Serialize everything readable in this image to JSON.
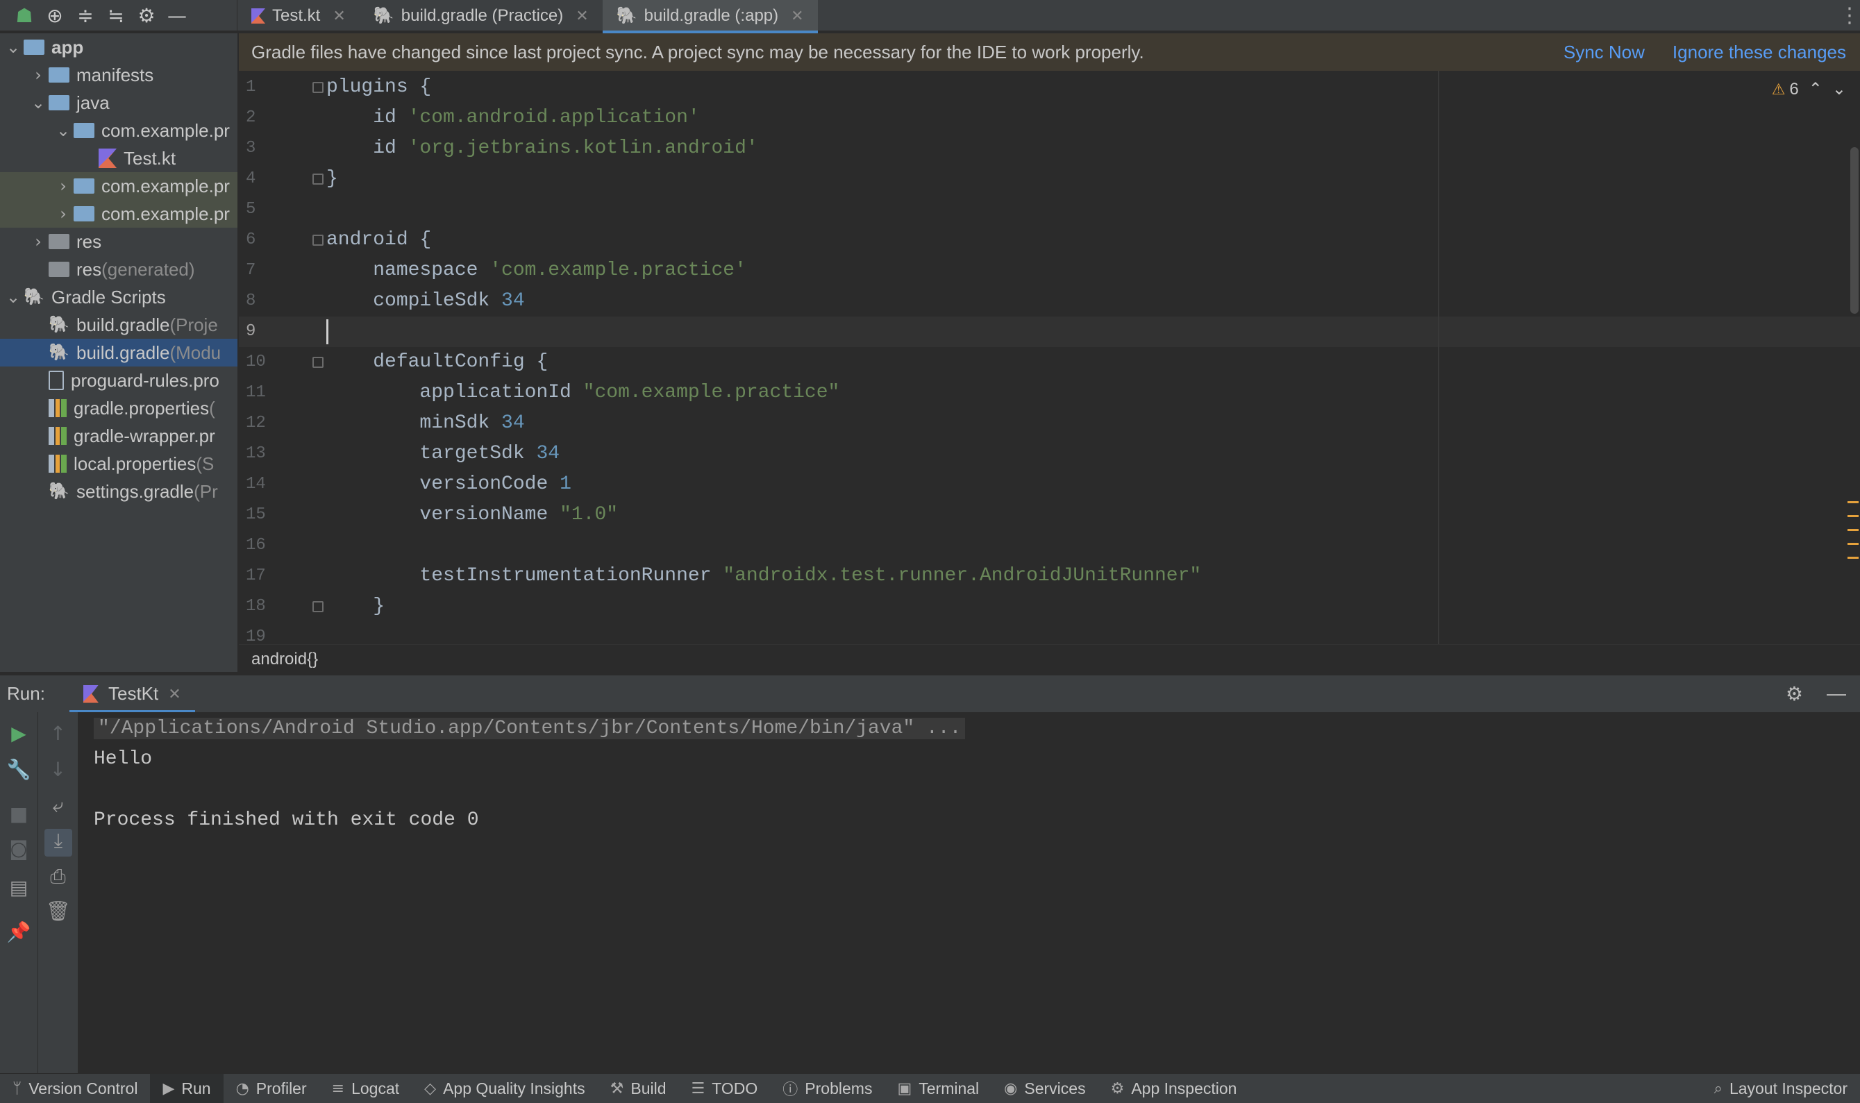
{
  "topbar": {
    "tool_icons": [
      "android-icon",
      "target-icon",
      "expand-all-icon",
      "collapse-all-icon",
      "gear-icon",
      "minimize-icon"
    ],
    "tabs": [
      {
        "label": "Test.kt",
        "icon": "kotlin-file-icon",
        "active": false
      },
      {
        "label": "build.gradle (Practice)",
        "icon": "gradle-icon",
        "active": false
      },
      {
        "label": "build.gradle (:app)",
        "icon": "gradle-icon",
        "active": true
      }
    ]
  },
  "tree": {
    "items": [
      {
        "label": "app",
        "suffix": "",
        "indent": 0,
        "chev": "v",
        "icon": "folder",
        "bold": true
      },
      {
        "label": "manifests",
        "suffix": "",
        "indent": 1,
        "chev": ">",
        "icon": "folder"
      },
      {
        "label": "java",
        "suffix": "",
        "indent": 1,
        "chev": "v",
        "icon": "folder"
      },
      {
        "label": "com.example.pr",
        "suffix": "",
        "indent": 2,
        "chev": "v",
        "icon": "folder"
      },
      {
        "label": "Test.kt",
        "suffix": "",
        "indent": 3,
        "chev": "",
        "icon": "kotlin"
      },
      {
        "label": "com.example.pr",
        "suffix": "",
        "indent": 2,
        "chev": ">",
        "icon": "folder",
        "hl": true
      },
      {
        "label": "com.example.pr",
        "suffix": "",
        "indent": 2,
        "chev": ">",
        "icon": "folder",
        "hl": true
      },
      {
        "label": "res",
        "suffix": "",
        "indent": 1,
        "chev": ">",
        "icon": "folder-grey"
      },
      {
        "label": "res",
        "suffix": " (generated)",
        "indent": 1,
        "chev": "",
        "icon": "folder-grey"
      },
      {
        "label": "Gradle Scripts",
        "suffix": "",
        "indent": 0,
        "chev": "v",
        "icon": "gradle"
      },
      {
        "label": "build.gradle",
        "suffix": " (Proje",
        "indent": 1,
        "chev": "",
        "icon": "gradle"
      },
      {
        "label": "build.gradle",
        "suffix": " (Modu",
        "indent": 1,
        "chev": "",
        "icon": "gradle",
        "selected": true
      },
      {
        "label": "proguard-rules.pro",
        "suffix": "",
        "indent": 1,
        "chev": "",
        "icon": "doc"
      },
      {
        "label": "gradle.properties",
        "suffix": " (",
        "indent": 1,
        "chev": "",
        "icon": "bars"
      },
      {
        "label": "gradle-wrapper.pr",
        "suffix": "",
        "indent": 1,
        "chev": "",
        "icon": "bars"
      },
      {
        "label": "local.properties",
        "suffix": " (S",
        "indent": 1,
        "chev": "",
        "icon": "bars"
      },
      {
        "label": "settings.gradle",
        "suffix": " (Pr",
        "indent": 1,
        "chev": "",
        "icon": "gradle"
      }
    ]
  },
  "banner": {
    "message": "Gradle files have changed since last project sync. A project sync may be necessary for the IDE to work properly.",
    "sync_now": "Sync Now",
    "ignore": "Ignore these changes"
  },
  "editor": {
    "warning_count": "6",
    "lines": [
      [
        {
          "t": "plugins {",
          "c": "plain"
        }
      ],
      [
        {
          "t": "    id ",
          "c": "plain"
        },
        {
          "t": "'com.android.application'",
          "c": "str"
        }
      ],
      [
        {
          "t": "    id ",
          "c": "plain"
        },
        {
          "t": "'org.jetbrains.kotlin.android'",
          "c": "str"
        }
      ],
      [
        {
          "t": "}",
          "c": "plain"
        }
      ],
      [],
      [
        {
          "t": "android {",
          "c": "plain"
        }
      ],
      [
        {
          "t": "    namespace ",
          "c": "plain"
        },
        {
          "t": "'com.example.practice'",
          "c": "str"
        }
      ],
      [
        {
          "t": "    compileSdk ",
          "c": "plain"
        },
        {
          "t": "34",
          "c": "num"
        }
      ],
      [],
      [
        {
          "t": "    defaultConfig {",
          "c": "plain"
        }
      ],
      [
        {
          "t": "        applicationId ",
          "c": "plain"
        },
        {
          "t": "\"com.example.practice\"",
          "c": "str"
        }
      ],
      [
        {
          "t": "        minSdk ",
          "c": "plain"
        },
        {
          "t": "34",
          "c": "num"
        }
      ],
      [
        {
          "t": "        targetSdk ",
          "c": "plain"
        },
        {
          "t": "34",
          "c": "num"
        }
      ],
      [
        {
          "t": "        versionCode ",
          "c": "plain"
        },
        {
          "t": "1",
          "c": "num"
        }
      ],
      [
        {
          "t": "        versionName ",
          "c": "plain"
        },
        {
          "t": "\"1.0\"",
          "c": "str"
        }
      ],
      [],
      [
        {
          "t": "        testInstrumentationRunner ",
          "c": "plain"
        },
        {
          "t": "\"androidx.test.runner.AndroidJUnitRunner\"",
          "c": "str"
        }
      ],
      [
        {
          "t": "    }",
          "c": "plain"
        }
      ],
      []
    ],
    "current_line": 9,
    "fold_lines": [
      1,
      4,
      6,
      10,
      18
    ]
  },
  "breadcrumb": "android{}",
  "run": {
    "label": "Run:",
    "tab": "TestKt",
    "console": [
      {
        "text": "\"/Applications/Android Studio.app/Contents/jbr/Contents/Home/bin/java\" ...",
        "cmd": true
      },
      {
        "text": "Hello",
        "cmd": false
      },
      {
        "text": "",
        "cmd": false
      },
      {
        "text": "Process finished with exit code 0",
        "cmd": false
      }
    ]
  },
  "statusbar": {
    "items": [
      {
        "label": "Version Control",
        "icon": "branch-icon",
        "glyph": "ᛘ"
      },
      {
        "label": "Run",
        "icon": "run-icon",
        "glyph": "▶",
        "active": true
      },
      {
        "label": "Profiler",
        "icon": "profiler-icon",
        "glyph": "◔"
      },
      {
        "label": "Logcat",
        "icon": "logcat-icon",
        "glyph": "≡"
      },
      {
        "label": "App Quality Insights",
        "icon": "diamond-icon",
        "glyph": "◇"
      },
      {
        "label": "Build",
        "icon": "hammer-icon",
        "glyph": "⚒"
      },
      {
        "label": "TODO",
        "icon": "list-icon",
        "glyph": "☰"
      },
      {
        "label": "Problems",
        "icon": "info-icon",
        "glyph": "ⓘ"
      },
      {
        "label": "Terminal",
        "icon": "terminal-icon",
        "glyph": "▣"
      },
      {
        "label": "Services",
        "icon": "services-icon",
        "glyph": "◉"
      },
      {
        "label": "App Inspection",
        "icon": "inspection-icon",
        "glyph": "⚙"
      }
    ],
    "right": {
      "label": "Layout Inspector",
      "icon": "layout-inspector-icon",
      "glyph": "⌕"
    }
  }
}
